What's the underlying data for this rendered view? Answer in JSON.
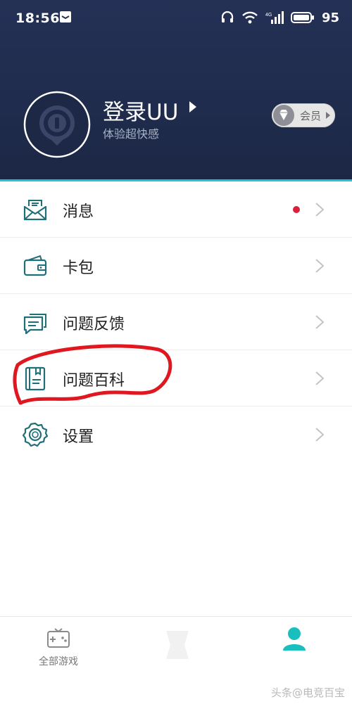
{
  "status_bar": {
    "time": "18:56",
    "battery": "95",
    "icons": [
      "notification-icon",
      "headset-icon",
      "wifi-icon",
      "signal-4g-icon",
      "battery-icon"
    ]
  },
  "header": {
    "login_title": "登录UU",
    "login_subtitle": "体验超快感",
    "vip_label": "会员",
    "colors": {
      "background": "#212d4f",
      "accent_line": "#22c2d6"
    }
  },
  "menu": {
    "items": [
      {
        "label": "消息",
        "icon": "envelope-icon",
        "has_unread": true
      },
      {
        "label": "卡包",
        "icon": "wallet-icon",
        "has_unread": false
      },
      {
        "label": "问题反馈",
        "icon": "feedback-chat-icon",
        "has_unread": false
      },
      {
        "label": "问题百科",
        "icon": "book-icon",
        "has_unread": false
      },
      {
        "label": "设置",
        "icon": "gear-icon",
        "has_unread": false
      }
    ],
    "icon_color": "#1f6f79",
    "unread_color": "#d8213e"
  },
  "bottom_nav": {
    "items": [
      {
        "label": "全部游戏",
        "icon": "gamepad-icon"
      },
      {
        "label": "",
        "icon": "boost-icon"
      },
      {
        "label": "",
        "icon": "profile-icon",
        "active": true
      }
    ],
    "active_color": "#19bfbf"
  },
  "watermark": "头条@电竞百宝"
}
